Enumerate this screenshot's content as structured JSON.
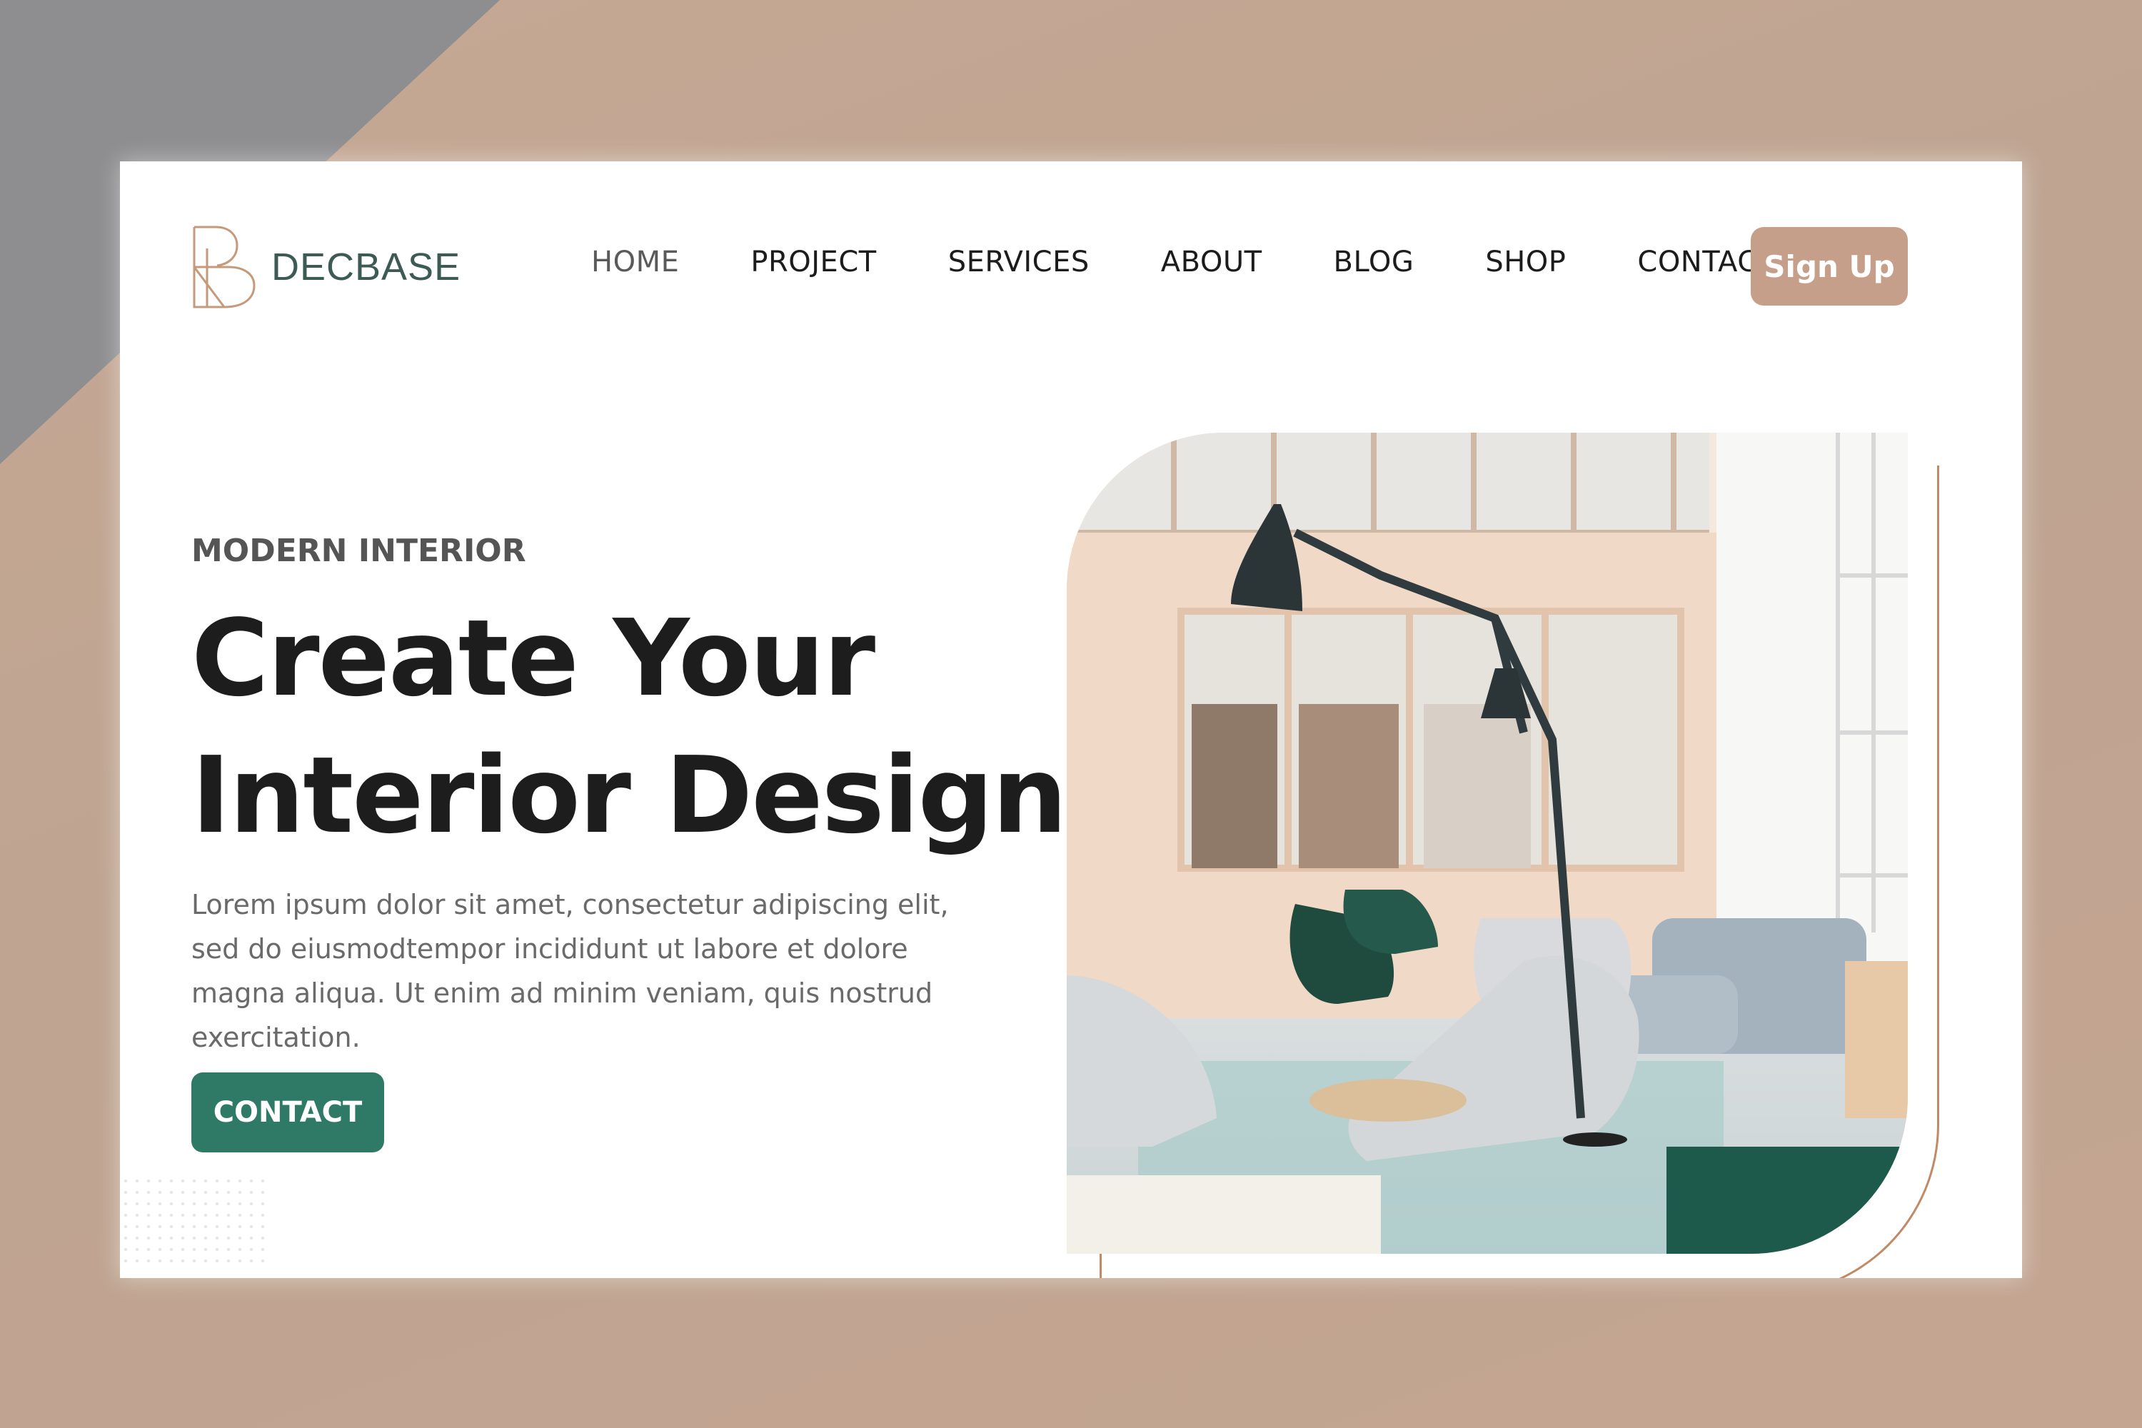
{
  "brand": {
    "name": "DECBASE",
    "logo_icon": "b-monogram-logo"
  },
  "nav": {
    "items": [
      {
        "label": "HOME",
        "active": true
      },
      {
        "label": "PROJECT"
      },
      {
        "label": "SERVICES"
      },
      {
        "label": "ABOUT"
      },
      {
        "label": "BLOG"
      },
      {
        "label": "SHOP"
      },
      {
        "label": "CONTACT"
      }
    ],
    "signup_label": "Sign Up"
  },
  "hero": {
    "eyebrow": "MODERN INTERIOR",
    "headline_line1": "Create Your",
    "headline_line2": "Interior Design.",
    "paragraph": "Lorem ipsum dolor sit amet, consectetur adipiscing elit, sed do eiusmodtempor incididunt ut labore et dolore magna aliqua. Ut enim ad minim veniam, quis nostrud exercitation.",
    "cta_label": "CONTACT"
  },
  "colors": {
    "accent_green": "#2f7a66",
    "accent_peach": "#c59f8a",
    "outline": "#c08a66",
    "background": "#c4a591"
  }
}
